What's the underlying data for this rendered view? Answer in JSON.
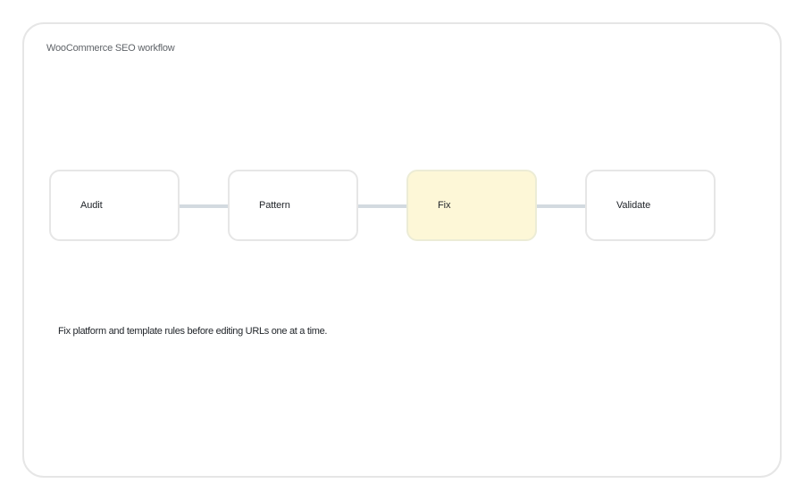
{
  "diagram": {
    "title": "WooCommerce SEO workflow",
    "steps": [
      {
        "label": "Audit",
        "active": false
      },
      {
        "label": "Pattern",
        "active": false
      },
      {
        "label": "Fix",
        "active": true
      },
      {
        "label": "Validate",
        "active": false
      }
    ],
    "note": "Fix platform and template rules before editing URLs one at a time.",
    "colors": {
      "frame_border": "#e6e6e6",
      "connector": "#d3dae0",
      "active_fill": "#fdf7d7",
      "step_fill": "#ffffff",
      "text": "#1f2328",
      "title_text": "#5f6368"
    }
  }
}
